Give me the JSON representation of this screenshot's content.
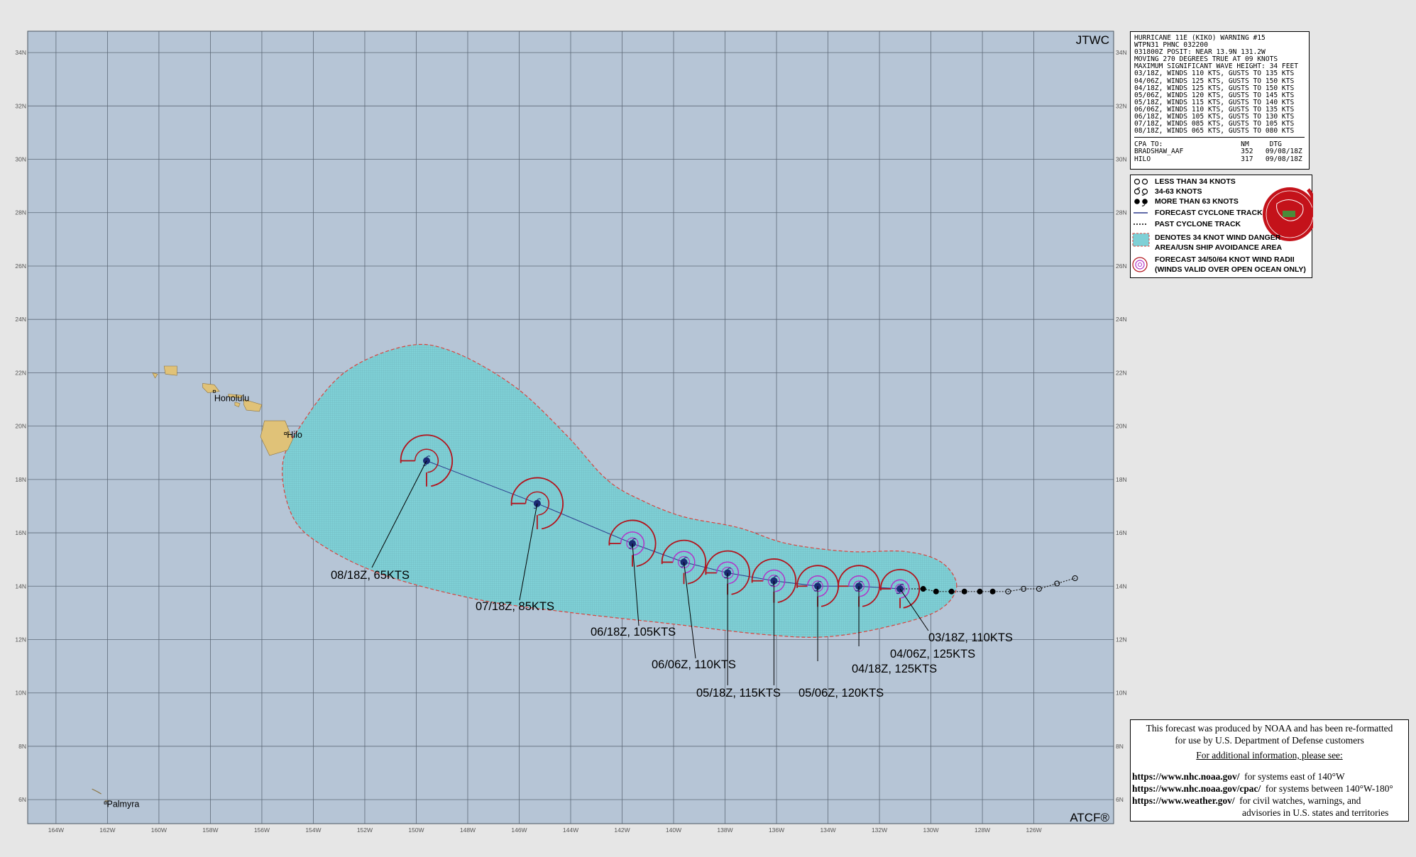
{
  "map": {
    "ocean_color": "#b6c5d6",
    "land_color": "#e0c278",
    "grid_color": "#5e6a78",
    "corner_labels": {
      "top_right": "JTWC",
      "bottom_right": "ATCF®"
    },
    "lat_labels": [
      {
        "lat": 34,
        "label": "34N"
      },
      {
        "lat": 32,
        "label": "32N"
      },
      {
        "lat": 30,
        "label": "30N"
      },
      {
        "lat": 28,
        "label": "28N"
      },
      {
        "lat": 26,
        "label": "26N"
      },
      {
        "lat": 24,
        "label": "24N"
      },
      {
        "lat": 22,
        "label": "22N"
      },
      {
        "lat": 20,
        "label": "20N"
      },
      {
        "lat": 18,
        "label": "18N"
      },
      {
        "lat": 16,
        "label": "16N"
      },
      {
        "lat": 14,
        "label": "14N"
      },
      {
        "lat": 12,
        "label": "12N"
      },
      {
        "lat": 10,
        "label": "10N"
      },
      {
        "lat": 8,
        "label": "8N"
      },
      {
        "lat": 6,
        "label": "6N"
      }
    ],
    "lon_labels": [
      {
        "lon": -164,
        "label": "164W"
      },
      {
        "lon": -162,
        "label": "162W"
      },
      {
        "lon": -160,
        "label": "160W"
      },
      {
        "lon": -158,
        "label": "158W"
      },
      {
        "lon": -156,
        "label": "156W"
      },
      {
        "lon": -154,
        "label": "154W"
      },
      {
        "lon": -152,
        "label": "152W"
      },
      {
        "lon": -150,
        "label": "150W"
      },
      {
        "lon": -148,
        "label": "148W"
      },
      {
        "lon": -146,
        "label": "146W"
      },
      {
        "lon": -144,
        "label": "144W"
      },
      {
        "lon": -142,
        "label": "142W"
      },
      {
        "lon": -140,
        "label": "140W"
      },
      {
        "lon": -138,
        "label": "138W"
      },
      {
        "lon": -136,
        "label": "136W"
      },
      {
        "lon": -134,
        "label": "134W"
      },
      {
        "lon": -132,
        "label": "132W"
      },
      {
        "lon": -130,
        "label": "130W"
      },
      {
        "lon": -128,
        "label": "128W"
      },
      {
        "lon": -126,
        "label": "126W"
      }
    ],
    "places": [
      {
        "name": "Honolulu",
        "lat": 21.3,
        "lon": -157.85
      },
      {
        "name": "Hilo",
        "lat": 19.72,
        "lon": -155.08
      },
      {
        "name": "Palmyra",
        "lat": 5.88,
        "lon": -162.08
      }
    ]
  },
  "track": {
    "forecast": [
      {
        "label": "03/18Z, 110KTS",
        "lat": 13.9,
        "lon": -131.2
      },
      {
        "label": "04/06Z, 125KTS",
        "lat": 14.0,
        "lon": -132.8
      },
      {
        "label": "04/18Z, 125KTS",
        "lat": 14.0,
        "lon": -134.4
      },
      {
        "label": "05/06Z, 120KTS",
        "lat": 14.2,
        "lon": -136.1
      },
      {
        "label": "05/18Z, 115KTS",
        "lat": 14.5,
        "lon": -137.9
      },
      {
        "label": "06/06Z, 110KTS",
        "lat": 14.9,
        "lon": -139.6
      },
      {
        "label": "06/18Z, 105KTS",
        "lat": 15.6,
        "lon": -141.6
      },
      {
        "label": "07/18Z,  85KTS",
        "lat": 17.1,
        "lon": -145.3
      },
      {
        "label": "08/18Z,  65KTS",
        "lat": 18.7,
        "lon": -149.6
      }
    ],
    "past": [
      {
        "lat": 13.9,
        "lon": -130.3
      },
      {
        "lat": 13.8,
        "lon": -129.8
      },
      {
        "lat": 13.8,
        "lon": -129.2
      },
      {
        "lat": 13.8,
        "lon": -128.7
      },
      {
        "lat": 13.8,
        "lon": -128.1
      },
      {
        "lat": 13.8,
        "lon": -127.6
      },
      {
        "lat": 13.8,
        "lon": -127.0
      },
      {
        "lat": 13.9,
        "lon": -126.4
      },
      {
        "lat": 13.9,
        "lon": -125.8
      },
      {
        "lat": 14.1,
        "lon": -125.1
      },
      {
        "lat": 14.3,
        "lon": -124.4
      }
    ],
    "danger_area_color": "#7fd0d6",
    "danger_outline_color": "#d9443d",
    "forecast_line_color": "#2b3a8c",
    "radii_color": "#b3131c",
    "inner_radii_color": "#b232c9"
  },
  "warning": {
    "lines": [
      "HURRICANE 11E (KIKO) WARNING #15",
      "WTPN31 PHNC 032200",
      "031800Z POSIT: NEAR 13.9N 131.2W",
      "MOVING 270 DEGREES TRUE AT 09 KNOTS",
      "MAXIMUM SIGNIFICANT WAVE HEIGHT: 34 FEET",
      "03/18Z, WINDS 110 KTS, GUSTS TO 135 KTS",
      "04/06Z, WINDS 125 KTS, GUSTS TO 150 KTS",
      "04/18Z, WINDS 125 KTS, GUSTS TO 150 KTS",
      "05/06Z, WINDS 120 KTS, GUSTS TO 145 KTS",
      "05/18Z, WINDS 115 KTS, GUSTS TO 140 KTS",
      "06/06Z, WINDS 110 KTS, GUSTS TO 135 KTS",
      "06/18Z, WINDS 105 KTS, GUSTS TO 130 KTS",
      "07/18Z, WINDS 085 KTS, GUSTS TO 105 KTS",
      "08/18Z, WINDS 065 KTS, GUSTS TO 080 KTS"
    ],
    "cpa_lines": [
      "CPA TO:                   NM     DTG",
      "BRADSHAW_AAF              352   09/08/18Z",
      "HILO                      317   09/08/18Z"
    ]
  },
  "legend": {
    "less_than_34": "LESS THAN 34 KNOTS",
    "k34_63": "34-63 KNOTS",
    "more_than_63": "MORE THAN 63 KNOTS",
    "forecast_track": "FORECAST CYCLONE TRACK",
    "past_track": "PAST CYCLONE TRACK",
    "danger_line1": "DENOTES 34 KNOT WIND DANGER",
    "danger_line2": "AREA/USN SHIP AVOIDANCE AREA",
    "radii_line1": "FORECAST 34/50/64 KNOT WIND RADII",
    "radii_line2": "(WINDS VALID OVER OPEN OCEAN ONLY)"
  },
  "info": {
    "line1": "This forecast was produced by NOAA and has been re-formatted",
    "line2": "for use by U.S. Department of Defense customers",
    "line3": "For additional information, please see:",
    "link1": "https://www.nhc.noaa.gov/",
    "desc1": "for systems east of 140°W",
    "link2": "https://www.nhc.noaa.gov/cpac/",
    "desc2": "for systems between 140°W-180°",
    "link3": "https://www.weather.gov/",
    "desc3a": "for civil watches, warnings, and",
    "desc3b": "advisories in U.S. states and territories"
  }
}
